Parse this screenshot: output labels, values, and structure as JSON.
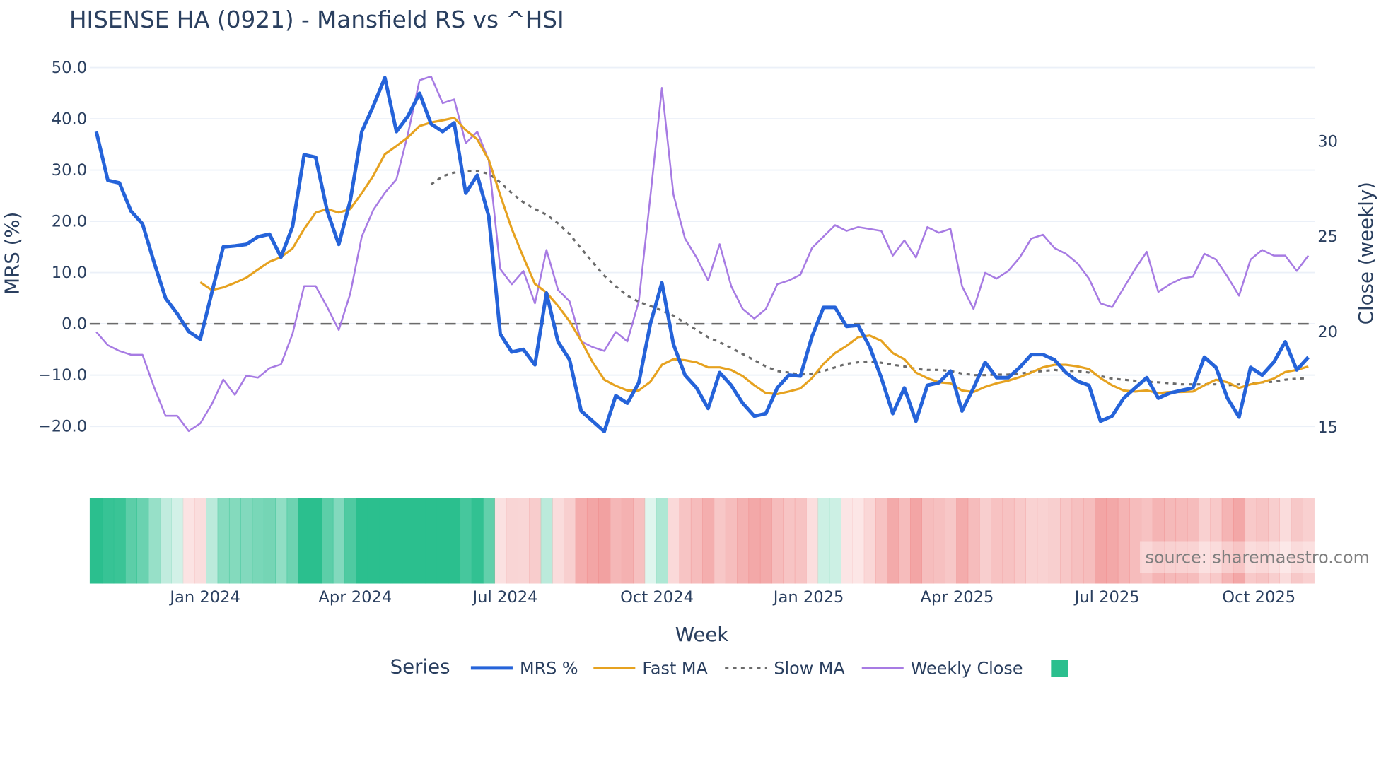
{
  "chart_data": {
    "type": "line",
    "title": "HISENSE HA (0921) - Mansfield RS vs ^HSI",
    "xlabel": "Week",
    "ylabel": "MRS (%)",
    "y2label": "Close (weekly)",
    "x_start_week": "2023-10-27",
    "x_interval_days": 7,
    "x_range": [
      "2023-10-23",
      "2025-11-04"
    ],
    "ylim": [
      -20,
      50
    ],
    "y2lim": [
      15,
      30
    ],
    "grid": true,
    "x_ticks": [
      {
        "date": "2024-01-01",
        "label": "Jan 2024"
      },
      {
        "date": "2024-04-01",
        "label": "Apr 2024"
      },
      {
        "date": "2024-07-01",
        "label": "Jul 2024"
      },
      {
        "date": "2024-10-01",
        "label": "Oct 2024"
      },
      {
        "date": "2025-01-01",
        "label": "Jan 2025"
      },
      {
        "date": "2025-04-01",
        "label": "Apr 2025"
      },
      {
        "date": "2025-07-01",
        "label": "Jul 2025"
      },
      {
        "date": "2025-10-01",
        "label": "Oct 2025"
      }
    ],
    "y_ticks": [
      {
        "value": 50,
        "label": "50.0"
      },
      {
        "value": 40,
        "label": "40.0"
      },
      {
        "value": 30,
        "label": "30.0"
      },
      {
        "value": 20,
        "label": "20.0"
      },
      {
        "value": 10,
        "label": "10.0"
      },
      {
        "value": 0,
        "label": "0.0"
      },
      {
        "value": -10,
        "label": "−10.0"
      },
      {
        "value": -20,
        "label": "−20.0"
      }
    ],
    "y2_ticks": [
      {
        "value": 30,
        "label": "30"
      },
      {
        "value": 25,
        "label": "25"
      },
      {
        "value": 20,
        "label": "20"
      },
      {
        "value": 15,
        "label": "15"
      }
    ],
    "zero_line": 0,
    "series": [
      {
        "name": "MRS %",
        "axis": "y",
        "color": "#2563d9",
        "style": "solid",
        "offset": 0,
        "values": [
          37.5,
          28,
          27.5,
          22,
          19.5,
          12,
          5,
          2,
          -1.5,
          -3,
          6,
          15,
          15.2,
          15.5,
          17,
          17.5,
          13,
          19,
          33,
          32.5,
          22,
          15.5,
          24,
          37.5,
          42.5,
          48,
          37.5,
          40.5,
          45,
          39,
          37.5,
          39.2,
          25.5,
          29,
          21,
          -2,
          -5.5,
          -5,
          -8,
          6,
          -3.5,
          -7,
          -17,
          -19,
          -21,
          -14,
          -15.5,
          -11.5,
          0,
          8,
          -4,
          -10,
          -12.5,
          -16.5,
          -9.5,
          -12,
          -15.5,
          -18,
          -17.5,
          -12.5,
          -10,
          -10.2,
          -2.5,
          3.2,
          3.2,
          -0.5,
          -0.3,
          -4.5,
          -10.5,
          -17.5,
          -12.5,
          -19,
          -12,
          -11.5,
          -9.2,
          -17,
          -12.5,
          -7.5,
          -10.5,
          -10.5,
          -8.5,
          -6,
          -6,
          -7,
          -9.5,
          -11.2,
          -12,
          -19,
          -18,
          -14.5,
          -12.5,
          -10.5,
          -14.5,
          -13.5,
          -13,
          -12.5,
          -6.5,
          -8.5,
          -14.5,
          -18.2,
          -8.5,
          -10,
          -7.5,
          -3.5,
          -9,
          -6.5
        ]
      },
      {
        "name": "Fast MA",
        "axis": "y",
        "color": "#e6a220",
        "style": "solid",
        "offset": 9,
        "values": [
          8.1,
          6.6,
          7.1,
          8.0,
          9.0,
          10.6,
          12.1,
          13.0,
          14.7,
          18.5,
          21.7,
          22.4,
          21.7,
          22.4,
          25.5,
          28.9,
          33.1,
          34.7,
          36.4,
          38.6,
          39.3,
          39.7,
          40.2,
          37.8,
          36.0,
          32.0,
          25.1,
          18.5,
          13.0,
          7.8,
          6.1,
          3.5,
          0.5,
          -3.3,
          -7.5,
          -10.9,
          -12.1,
          -13.0,
          -13.0,
          -11.3,
          -8.0,
          -6.9,
          -7.1,
          -7.5,
          -8.5,
          -8.5,
          -9.0,
          -10.2,
          -12.0,
          -13.5,
          -13.7,
          -13.2,
          -12.6,
          -10.6,
          -7.8,
          -5.7,
          -4.3,
          -2.6,
          -2.3,
          -3.3,
          -5.7,
          -6.9,
          -9.5,
          -10.6,
          -11.4,
          -11.6,
          -13.0,
          -13.3,
          -12.3,
          -11.6,
          -11.1,
          -10.4,
          -9.5,
          -8.5,
          -8.0,
          -8.0,
          -8.3,
          -8.8,
          -10.6,
          -12.0,
          -13.0,
          -13.2,
          -13.0,
          -13.5,
          -13.3,
          -13.3,
          -13.2,
          -12.0,
          -10.9,
          -11.4,
          -12.5,
          -11.8,
          -11.4,
          -10.7,
          -9.4,
          -9.0,
          -8.3
        ]
      },
      {
        "name": "Slow MA",
        "axis": "y",
        "color": "#6b6b6b",
        "style": "dotted",
        "offset": 29,
        "values": [
          27.2,
          28.8,
          29.5,
          29.8,
          29.8,
          29.3,
          27.6,
          25.5,
          23.7,
          22.4,
          21.3,
          19.6,
          17.5,
          14.7,
          12.0,
          9.4,
          7.3,
          5.5,
          4.3,
          3.5,
          2.6,
          1.6,
          0.2,
          -1.2,
          -2.6,
          -3.6,
          -4.7,
          -5.9,
          -7.1,
          -8.3,
          -9.2,
          -9.5,
          -9.9,
          -9.7,
          -9.2,
          -8.5,
          -7.8,
          -7.5,
          -7.3,
          -7.6,
          -8.0,
          -8.3,
          -8.8,
          -9.0,
          -9.0,
          -9.2,
          -9.7,
          -10.0,
          -10.0,
          -9.9,
          -9.9,
          -9.7,
          -9.4,
          -9.2,
          -9.0,
          -9.2,
          -9.2,
          -9.5,
          -10.2,
          -10.7,
          -10.9,
          -11.1,
          -11.3,
          -11.4,
          -11.6,
          -11.8,
          -11.8,
          -11.8,
          -11.8,
          -12.0,
          -11.8,
          -11.6,
          -11.4,
          -11.3,
          -10.9,
          -10.7,
          -10.6
        ]
      },
      {
        "name": "Weekly Close",
        "axis": "y2",
        "color": "#a77be3",
        "style": "solid",
        "offset": 0,
        "values": [
          20.0,
          19.3,
          19.0,
          18.8,
          18.8,
          17.1,
          15.6,
          15.6,
          14.8,
          15.2,
          16.2,
          17.5,
          16.7,
          17.7,
          17.6,
          18.1,
          18.3,
          19.9,
          22.4,
          22.4,
          21.3,
          20.1,
          22.0,
          25.0,
          26.4,
          27.3,
          28.0,
          30.4,
          33.2,
          33.4,
          32.0,
          32.2,
          29.9,
          30.5,
          29.0,
          23.3,
          22.5,
          23.2,
          21.5,
          24.3,
          22.2,
          21.6,
          19.5,
          19.2,
          19.0,
          20.0,
          19.5,
          21.6,
          27.1,
          32.8,
          27.2,
          24.9,
          23.9,
          22.7,
          24.6,
          22.4,
          21.2,
          20.7,
          21.2,
          22.5,
          22.7,
          23.0,
          24.4,
          25.0,
          25.6,
          25.3,
          25.5,
          25.4,
          25.3,
          24.0,
          24.8,
          23.9,
          25.5,
          25.2,
          25.4,
          22.4,
          21.2,
          23.1,
          22.8,
          23.2,
          23.9,
          24.9,
          25.1,
          24.4,
          24.1,
          23.6,
          22.8,
          21.5,
          21.3,
          22.3,
          23.3,
          24.2,
          22.1,
          22.5,
          22.8,
          22.9,
          24.1,
          23.8,
          22.9,
          21.9,
          23.8,
          24.3,
          24.0,
          24.0,
          23.2,
          24.0
        ]
      }
    ],
    "heatmap": {
      "source_series": "MRS %",
      "positive_color": "#2bbf8e",
      "negative_color": "#ef8a8a"
    },
    "legend": {
      "title": "Series",
      "placement": "bottom",
      "items": [
        "MRS %",
        "Fast MA",
        "Slow MA",
        "Weekly Close"
      ],
      "extra_swatch_color": "#2bbf8e"
    },
    "annotation": "source: sharemaestro.com"
  }
}
